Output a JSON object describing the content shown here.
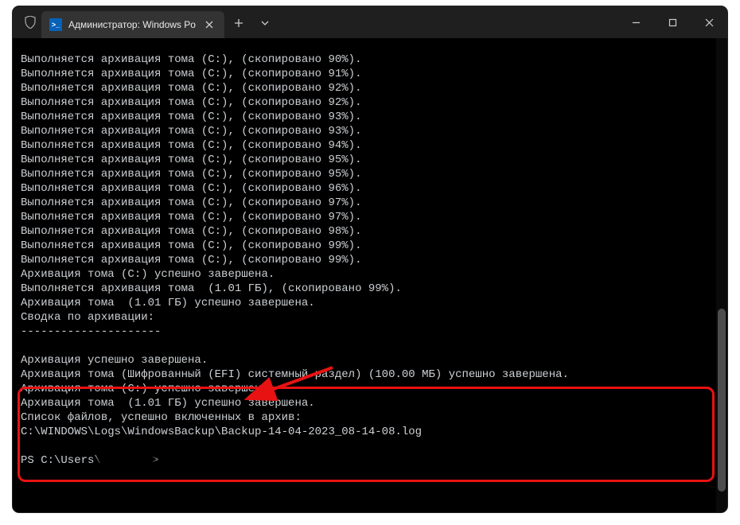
{
  "titlebar": {
    "tab_title": "Администратор: Windows Po",
    "tab_icon_text": ">_"
  },
  "terminal": {
    "progress_lines": [
      "Выполняется архивация тома (C:), (скопировано 90%).",
      "Выполняется архивация тома (C:), (скопировано 91%).",
      "Выполняется архивация тома (C:), (скопировано 92%).",
      "Выполняется архивация тома (C:), (скопировано 92%).",
      "Выполняется архивация тома (C:), (скопировано 93%).",
      "Выполняется архивация тома (C:), (скопировано 93%).",
      "Выполняется архивация тома (C:), (скопировано 94%).",
      "Выполняется архивация тома (C:), (скопировано 95%).",
      "Выполняется архивация тома (C:), (скопировано 95%).",
      "Выполняется архивация тома (C:), (скопировано 96%).",
      "Выполняется архивация тома (C:), (скопировано 97%).",
      "Выполняется архивация тома (C:), (скопировано 97%).",
      "Выполняется архивация тома (C:), (скопировано 98%).",
      "Выполняется архивация тома (C:), (скопировано 99%).",
      "Выполняется архивация тома (C:), (скопировано 99%).",
      "Архивация тома (C:) успешно завершена.",
      "Выполняется архивация тома  (1.01 ГБ), (скопировано 99%).",
      "Архивация тома  (1.01 ГБ) успешно завершена.",
      "Сводка по архивации:",
      "---------------------",
      "",
      "Архивация успешно завершена.",
      "Архивация тома (Шифрованный (EFI) системный раздел) (100.00 МБ) успешно завершена.",
      "Архивация тома (C:) успешно завершена.",
      "Архивация тома  (1.01 ГБ) успешно завершена.",
      "Список файлов, успешно включенных в архив:",
      "C:\\WINDOWS\\Logs\\WindowsBackup\\Backup-14-04-2023_08-14-08.log",
      ""
    ],
    "prompt_prefix": "PS C:\\Users\\",
    "prompt_suffix": ">"
  }
}
